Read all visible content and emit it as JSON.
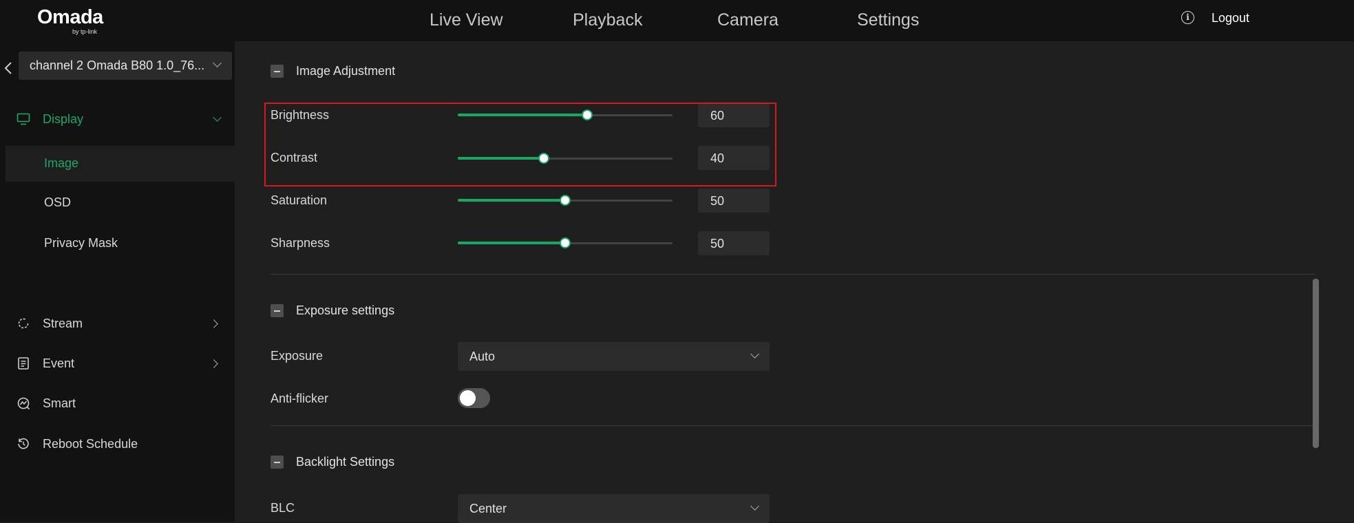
{
  "brand": {
    "name": "Omada",
    "tagline": "by tp-link"
  },
  "nav": {
    "items": [
      "Live View",
      "Playback",
      "Camera",
      "Settings"
    ]
  },
  "header": {
    "logout_label": "Logout",
    "info_icon": "info-icon"
  },
  "sidebar": {
    "channel": "channel 2 Omada B80 1.0_76...",
    "menu": [
      {
        "label": "Display",
        "icon": "monitor-icon",
        "expanded": true
      },
      {
        "label": "Stream",
        "icon": "refresh-icon"
      },
      {
        "label": "Event",
        "icon": "document-icon"
      },
      {
        "label": "Smart",
        "icon": "smart-icon"
      },
      {
        "label": "Reboot Schedule",
        "icon": "reboot-icon"
      }
    ],
    "submenu": [
      {
        "label": "Image",
        "selected": true
      },
      {
        "label": "OSD"
      },
      {
        "label": "Privacy Mask"
      }
    ]
  },
  "image_adjustment": {
    "title": "Image Adjustment",
    "brightness": {
      "label": "Brightness",
      "value": "60"
    },
    "contrast": {
      "label": "Contrast",
      "value": "40"
    },
    "saturation": {
      "label": "Saturation",
      "value": "50"
    },
    "sharpness": {
      "label": "Sharpness",
      "value": "50"
    }
  },
  "exposure": {
    "title": "Exposure settings",
    "exposure_label": "Exposure",
    "exposure_value": "Auto",
    "antiflicker_label": "Anti-flicker",
    "antiflicker_on": false
  },
  "backlight": {
    "title": "Backlight Settings",
    "blc_label": "BLC",
    "blc_value": "Center"
  },
  "colors": {
    "accent": "#1ea769",
    "highlight_border": "#d8181e",
    "background": "#1f1f1f",
    "sidebar": "#121212"
  }
}
